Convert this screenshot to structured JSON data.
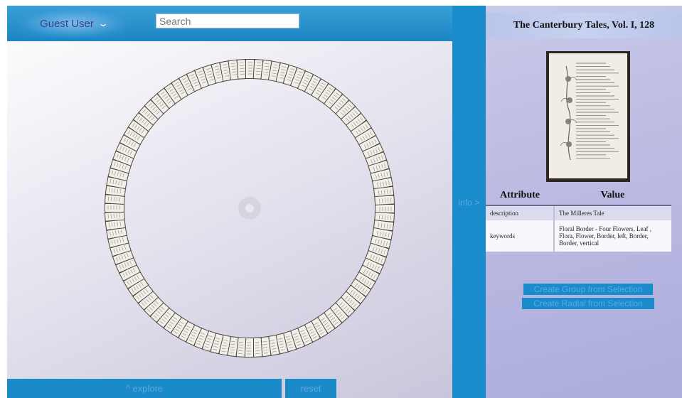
{
  "header": {
    "user_label": "Guest User",
    "user_dropdown_icon": "chevron-down-icon",
    "search_placeholder": "Search"
  },
  "bottom_bar": {
    "explore_label": "^ explore",
    "reset_label": "reset"
  },
  "info_toggle": {
    "label": "info >"
  },
  "detail": {
    "title": "The Canterbury Tales, Vol. I, 128",
    "table_headers": [
      "Attribute",
      "Value"
    ],
    "rows": [
      {
        "attribute": "description",
        "value": "The Milleres Tale"
      },
      {
        "attribute": "keywords",
        "value": "Floral Border - Four Flowers, Leaf , Flora, Flower, Border, left, Border, Border, vertical"
      }
    ]
  },
  "actions": {
    "create_group": "Create Group from Selection",
    "create_radial": "Create Radial from Selection"
  },
  "colors": {
    "accent_blue": "#1a8ccc",
    "dim_text": "#5aa8e3",
    "panel_bg": "#b9b9e2"
  }
}
